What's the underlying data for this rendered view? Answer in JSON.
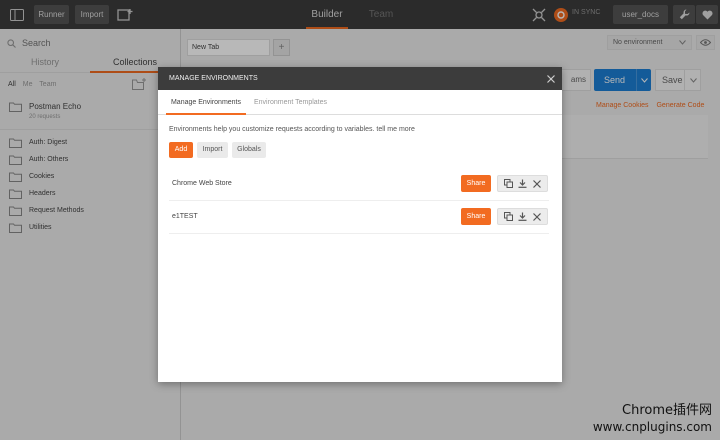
{
  "topbar": {
    "runner_label": "Runner",
    "import_label": "Import",
    "tabs": [
      {
        "label": "Builder",
        "active": true
      },
      {
        "label": "Team Library",
        "active": false
      }
    ],
    "sync_label": "IN SYNC",
    "user_label": "user_docs"
  },
  "sidebar": {
    "search_placeholder": "Search",
    "tabs": [
      {
        "label": "History",
        "active": false
      },
      {
        "label": "Collections",
        "active": true
      }
    ],
    "filters": {
      "all": "All",
      "me": "Me",
      "team": "Team"
    },
    "collections": [
      {
        "name": "Postman Echo",
        "sub": "20 requests"
      },
      {
        "name": "Auth: Digest"
      },
      {
        "name": "Auth: Others"
      },
      {
        "name": "Cookies"
      },
      {
        "name": "Headers"
      },
      {
        "name": "Request Methods"
      },
      {
        "name": "Utilities"
      }
    ]
  },
  "builder": {
    "request_tab": "New Tab",
    "add_tab": "+",
    "environment": "No environment",
    "params_label": "ams",
    "send_label": "Send",
    "save_label": "Save",
    "links": {
      "cookies": "Manage Cookies",
      "code": "Generate Code"
    }
  },
  "modal": {
    "title": "MANAGE ENVIRONMENTS",
    "tabs": [
      {
        "label": "Manage Environments",
        "active": true
      },
      {
        "label": "Environment Templates",
        "active": false
      }
    ],
    "description": "Environments help you customize requests according to variables. tell me more",
    "buttons": {
      "add": "Add",
      "import": "Import",
      "globals": "Globals"
    },
    "environments": [
      {
        "name": "Chrome Web Store",
        "share": "Share"
      },
      {
        "name": "e1TEST",
        "share": "Share"
      }
    ]
  },
  "watermark": {
    "line1": "Chrome插件网",
    "line2": "www.cnplugins.com"
  },
  "colors": {
    "accent": "#f26b21",
    "send": "#1d7ed4",
    "topbar": "#3c3c3c"
  }
}
